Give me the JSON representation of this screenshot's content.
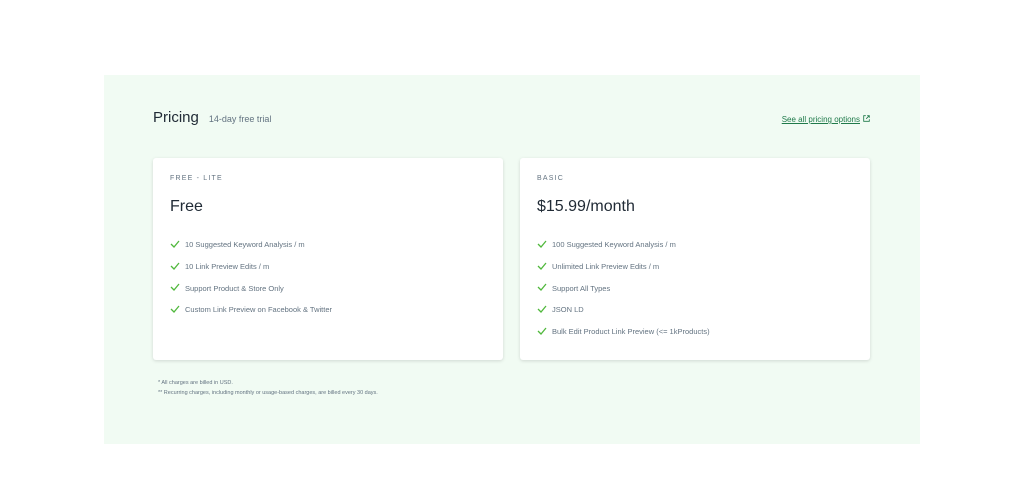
{
  "pricing": {
    "title": "Pricing",
    "subtitle": "14-day free trial",
    "see_all_label": "See all pricing options",
    "plans": [
      {
        "name": "FREE - LITE",
        "price": "Free",
        "features": [
          "10 Suggested Keyword Analysis / m",
          "10 Link Preview Edits / m",
          "Support Product & Store Only",
          "Custom Link Preview on Facebook & Twitter"
        ]
      },
      {
        "name": "BASIC",
        "price": "$15.99/month",
        "features": [
          "100 Suggested Keyword Analysis / m",
          "Unlimited Link Preview Edits / m",
          "Support All Types",
          "JSON LD",
          "Bulk Edit Product Link Preview (<= 1kProducts)"
        ]
      }
    ],
    "footnotes": [
      "* All charges are billed in USD.",
      "** Recurring charges, including monthly or usage-based charges, are billed every 30 days."
    ]
  },
  "colors": {
    "panel_background": "#f1fbf3",
    "check": "#50b83c",
    "link": "#1f7a4a"
  },
  "icons": {
    "feature": "checkmark-icon",
    "external": "external-link-icon"
  }
}
